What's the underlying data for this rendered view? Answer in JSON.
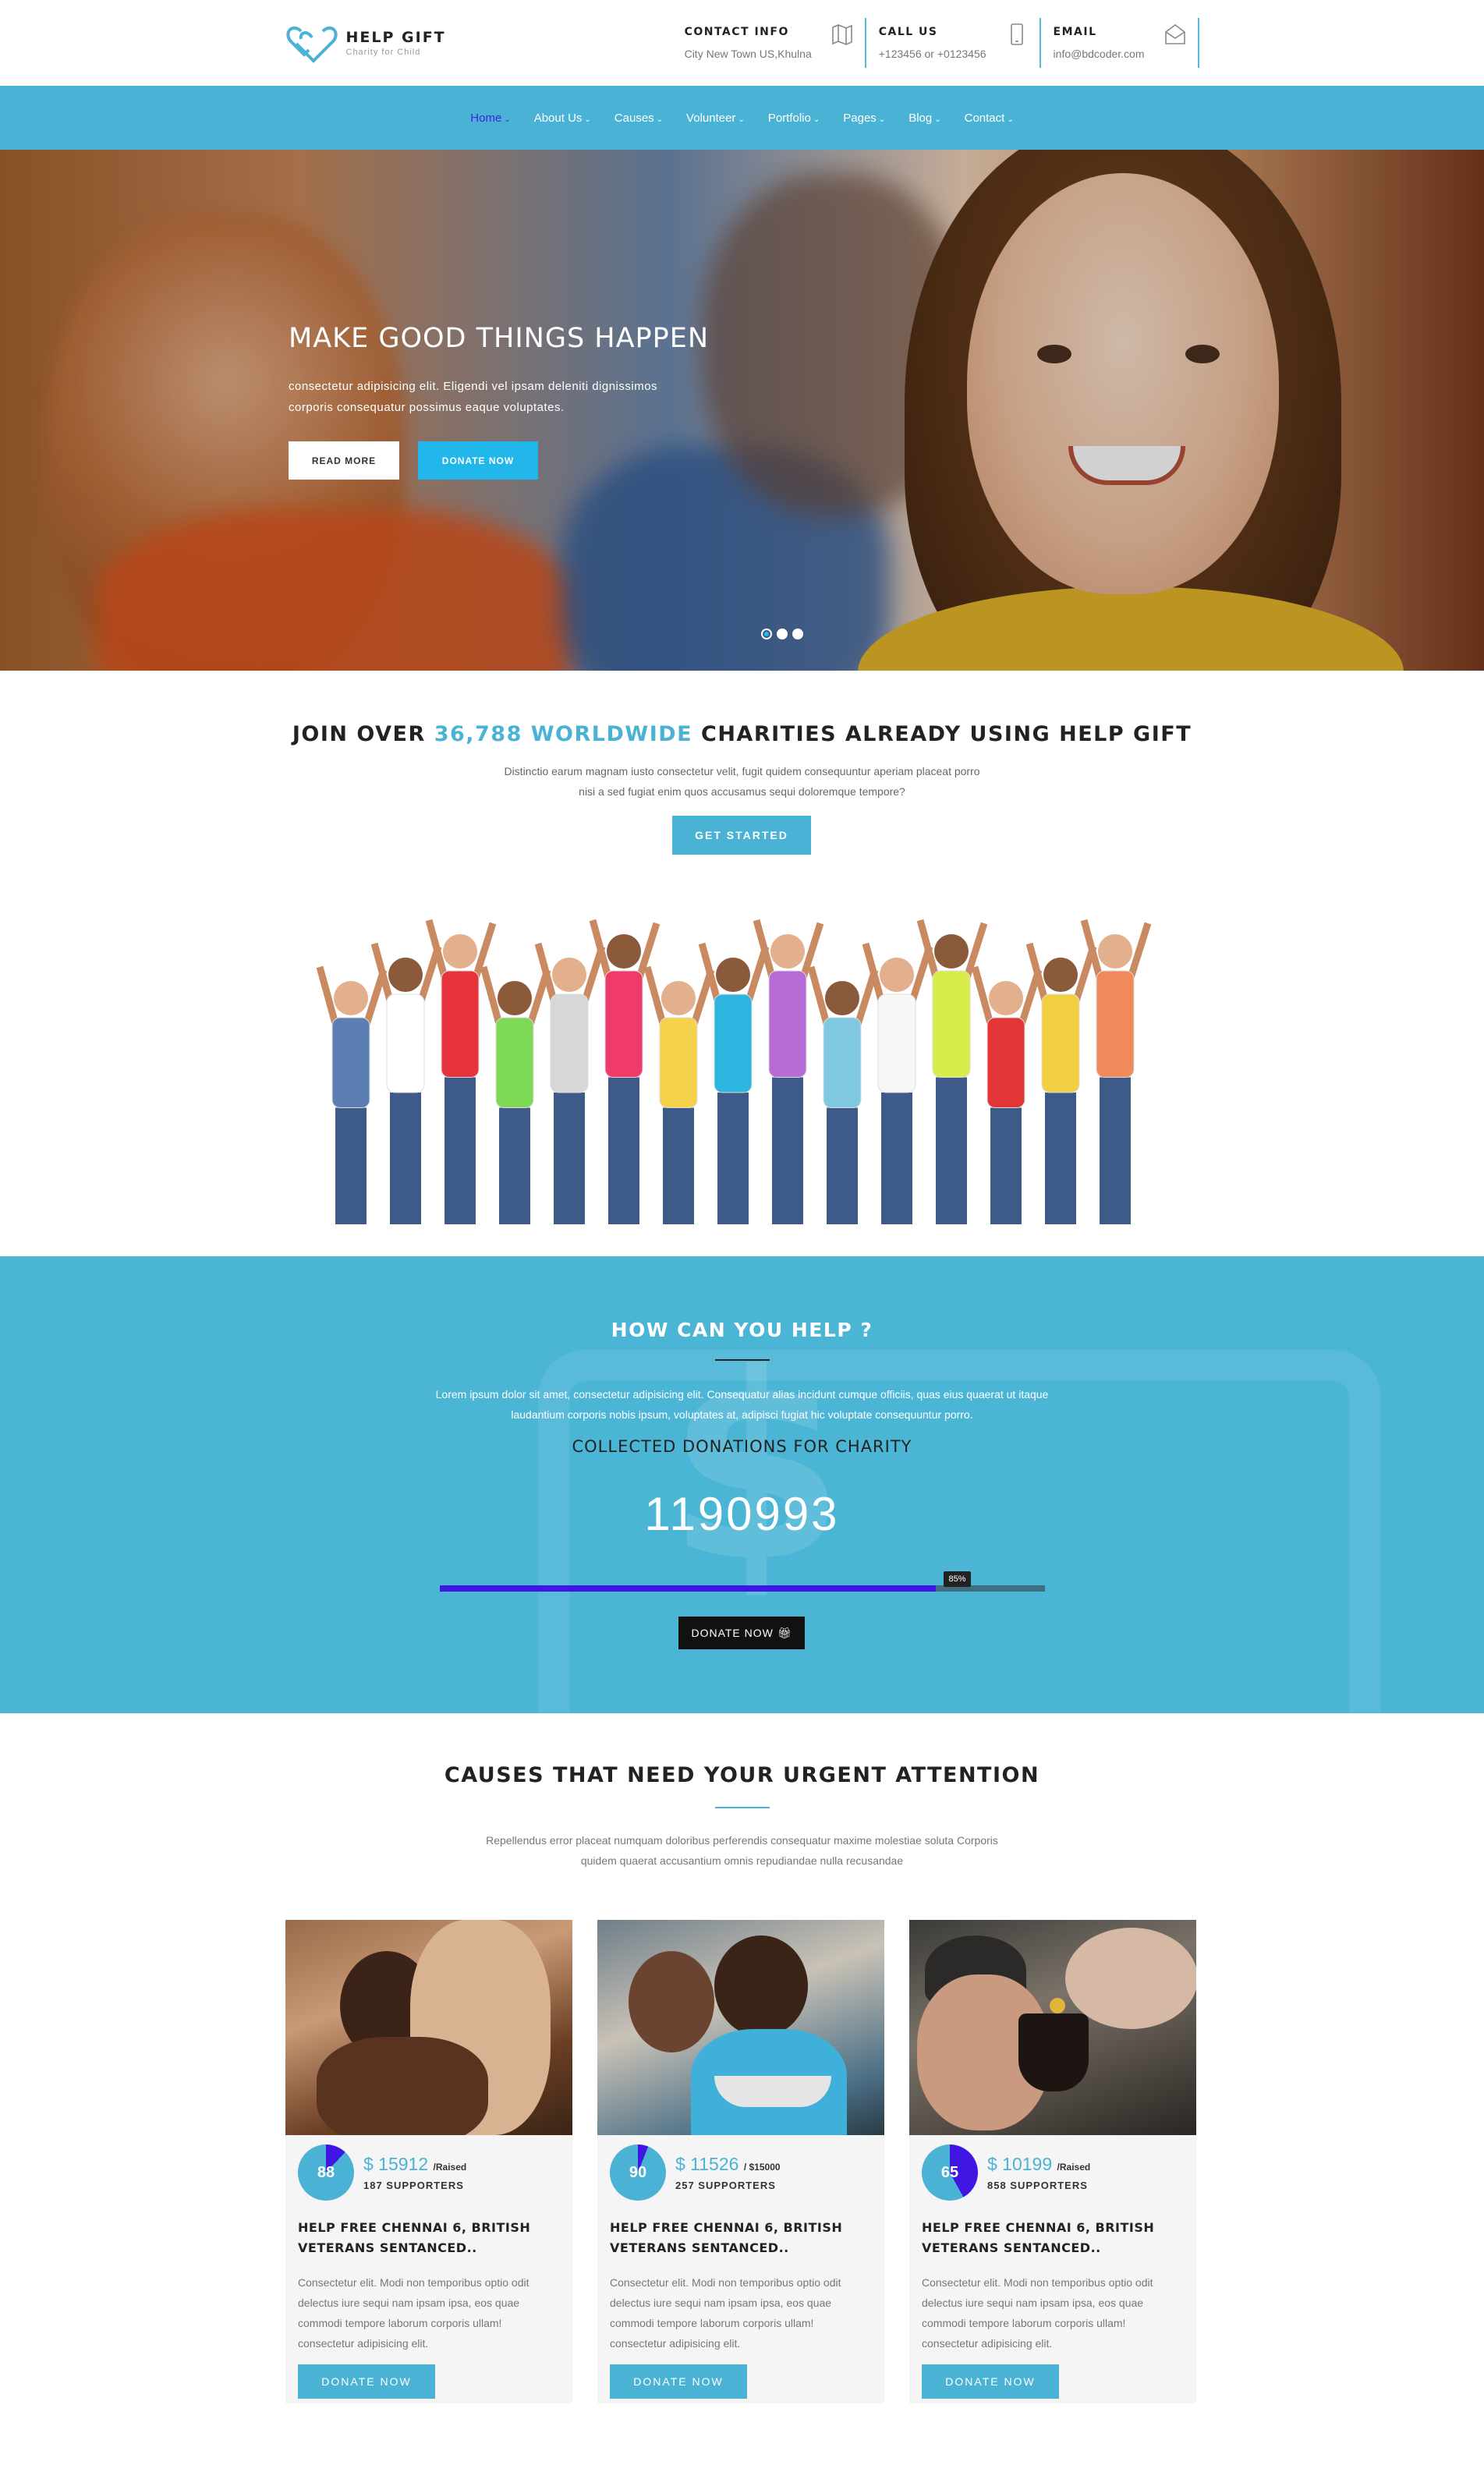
{
  "brand": {
    "name": "HELP GIFT",
    "tagline": "Charity for Child"
  },
  "contacts": [
    {
      "title": "CONTACT INFO",
      "value": "City New Town US,Khulna",
      "icon": "map-icon"
    },
    {
      "title": "CALL US",
      "value": "+123456 or +0123456",
      "icon": "phone-icon"
    },
    {
      "title": "EMAIL",
      "value": "info@bdcoder.com",
      "icon": "envelope-icon"
    }
  ],
  "nav": {
    "items": [
      "Home",
      "About Us",
      "Causes",
      "Volunteer",
      "Portfolio",
      "Pages",
      "Blog",
      "Contact"
    ],
    "active": "Home"
  },
  "hero": {
    "title": "MAKE GOOD THINGS HAPPEN",
    "desc_line1": "consectetur adipisicing elit. Eligendi vel ipsam deleniti dignissimos",
    "desc_line2": "corporis consequatur possimus eaque voluptates.",
    "read_more": "READ MORE",
    "donate": "DONATE NOW"
  },
  "join": {
    "title_pre": "JOIN OVER",
    "title_highlight": "36,788 WORLDWIDE",
    "title_post": "CHARITIES ALREADY USING HELP GIFT",
    "desc_line1": "Distinctio earum magnam iusto consectetur velit, fugit quidem consequuntur aperiam placeat porro",
    "desc_line2": "nisi a sed fugiat enim quos accusamus sequi doloremque tempore?",
    "button": "GET STARTED"
  },
  "help": {
    "title": "HOW CAN YOU HELP ?",
    "desc_line1": "Lorem ipsum dolor sit amet, consectetur adipisicing elit. Consequatur alias incidunt cumque officiis, quas eius quaerat ut itaque",
    "desc_line2": "laudantium corporis nobis ipsum, voluptates at, adipisci fugiat hic voluptate consequuntur porro.",
    "subtitle": "COLLECTED DONATIONS FOR CHARITY",
    "amount": "1190993",
    "progress_label": "85%",
    "progress_value": 0.82,
    "button": "DONATE NOW"
  },
  "causes": {
    "title": "CAUSES THAT NEED YOUR URGENT ATTENTION",
    "desc_line1": "Repellendus error placeat numquam doloribus perferendis consequatur maxime molestiae soluta Corporis",
    "desc_line2": "quidem quaerat accusantium omnis repudiandae nulla recusandae",
    "cards": [
      {
        "percent": "88",
        "percent_value": 0.12,
        "amount": "$ 15912",
        "amount_suffix": "/Raised",
        "supporters": "187 SUPPORTERS",
        "title_line1": "HELP FREE CHENNAI 6, BRITISH",
        "title_line2": "VETERANS SENTANCED..",
        "text": "Consectetur elit. Modi non temporibus optio odit delectus iure sequi nam ipsam ipsa, eos quae commodi tempore laborum corporis ullam! consectetur adipisicing elit.",
        "button": "DONATE NOW"
      },
      {
        "percent": "90",
        "percent_value": 0.06,
        "amount": "$ 11526",
        "amount_suffix": "/ $15000",
        "supporters": "257 SUPPORTERS",
        "title_line1": "HELP FREE CHENNAI 6, BRITISH",
        "title_line2": "VETERANS SENTANCED..",
        "text": "Consectetur elit. Modi non temporibus optio odit delectus iure sequi nam ipsam ipsa, eos quae commodi tempore laborum corporis ullam! consectetur adipisicing elit.",
        "button": "DONATE NOW"
      },
      {
        "percent": "65",
        "percent_value": 0.42,
        "amount": "$ 10199",
        "amount_suffix": "/Raised",
        "supporters": "858 SUPPORTERS",
        "title_line1": "HELP FREE CHENNAI 6, BRITISH",
        "title_line2": "VETERANS SENTANCED..",
        "text": "Consectetur elit. Modi non temporibus optio odit delectus iure sequi nam ipsam ipsa, eos quae commodi tempore laborum corporis ullam! consectetur adipisicing elit.",
        "button": "DONATE NOW"
      }
    ]
  },
  "colors": {
    "accent": "#4ab3d5",
    "nav_active": "#3a27d9",
    "progress": "#4016e3",
    "hero_donate": "#22b7ea"
  }
}
